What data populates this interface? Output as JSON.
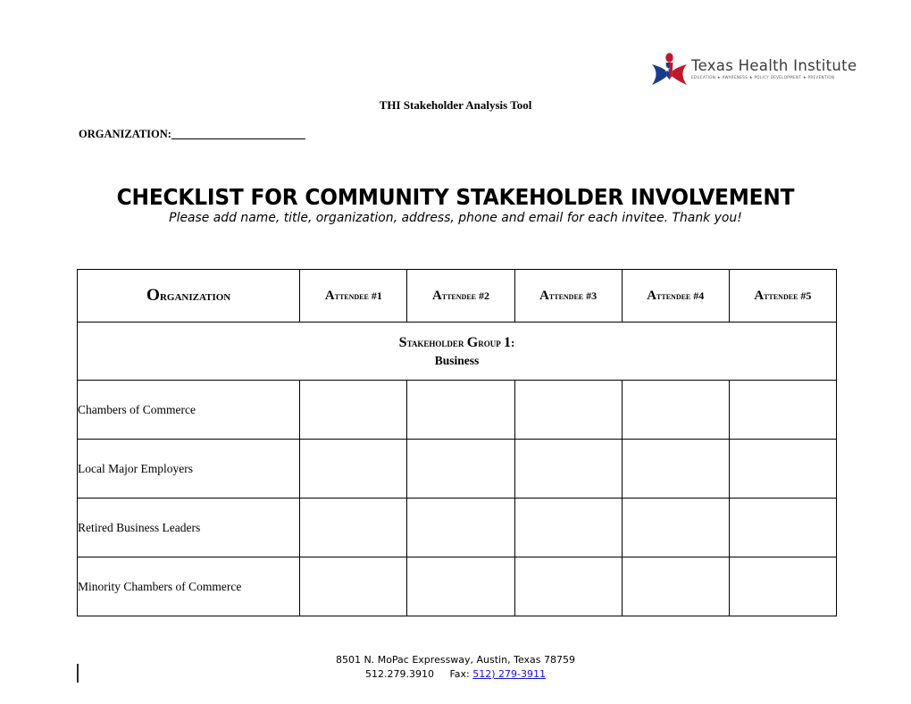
{
  "logo": {
    "wordmark": "Texas Health Institute",
    "tagline_parts": [
      "EDUCATION",
      "AWARENESS",
      "POLICY DEVELOPMENT",
      "PREVENTION"
    ],
    "tagline": "EDUCATION ★ AWARENESS ★ POLICY DEVELOPMENT ★ PREVENTION",
    "icon_name": "texas-health-institute-logo",
    "colors": {
      "blue": "#1b3a8c",
      "red": "#c0182b",
      "white": "#ffffff",
      "text": "#3a3a3a"
    }
  },
  "header": {
    "doc_header": "THI Stakeholder Analysis Tool",
    "organization_label": "ORGANIZATION:",
    "organization_value": "",
    "organization_blank": "                                                "
  },
  "title": {
    "main": "CHECKLIST FOR COMMUNITY STAKEHOLDER INVOLVEMENT",
    "subtitle": "Please add name, title, organization, address, phone and email for each invitee. Thank you!"
  },
  "table": {
    "columns": [
      {
        "label": "Organization",
        "key": "organization"
      },
      {
        "label": "Attendee #1",
        "key": "attendee_1"
      },
      {
        "label": "Attendee #2",
        "key": "attendee_2"
      },
      {
        "label": "Attendee #3",
        "key": "attendee_3"
      },
      {
        "label": "Attendee #4",
        "key": "attendee_4"
      },
      {
        "label": "Attendee #5",
        "key": "attendee_5"
      }
    ],
    "group": {
      "line1": "Stakeholder Group 1:",
      "line2": "Business"
    },
    "rows": [
      {
        "label": "Chambers of Commerce",
        "cells": [
          "",
          "",
          "",
          "",
          ""
        ]
      },
      {
        "label": "Local Major Employers",
        "cells": [
          "",
          "",
          "",
          "",
          ""
        ]
      },
      {
        "label": "Retired Business Leaders",
        "cells": [
          "",
          "",
          "",
          "",
          ""
        ]
      },
      {
        "label": "Minority Chambers of Commerce",
        "cells": [
          "",
          "",
          "",
          "",
          ""
        ]
      }
    ]
  },
  "footer": {
    "address": "8501 N. MoPac Expressway, Austin, Texas 78759",
    "phone": "512.279.3910",
    "fax_label": "Fax:",
    "fax_number": "512) 279-3911",
    "fax_link_color": "#1414c8"
  }
}
